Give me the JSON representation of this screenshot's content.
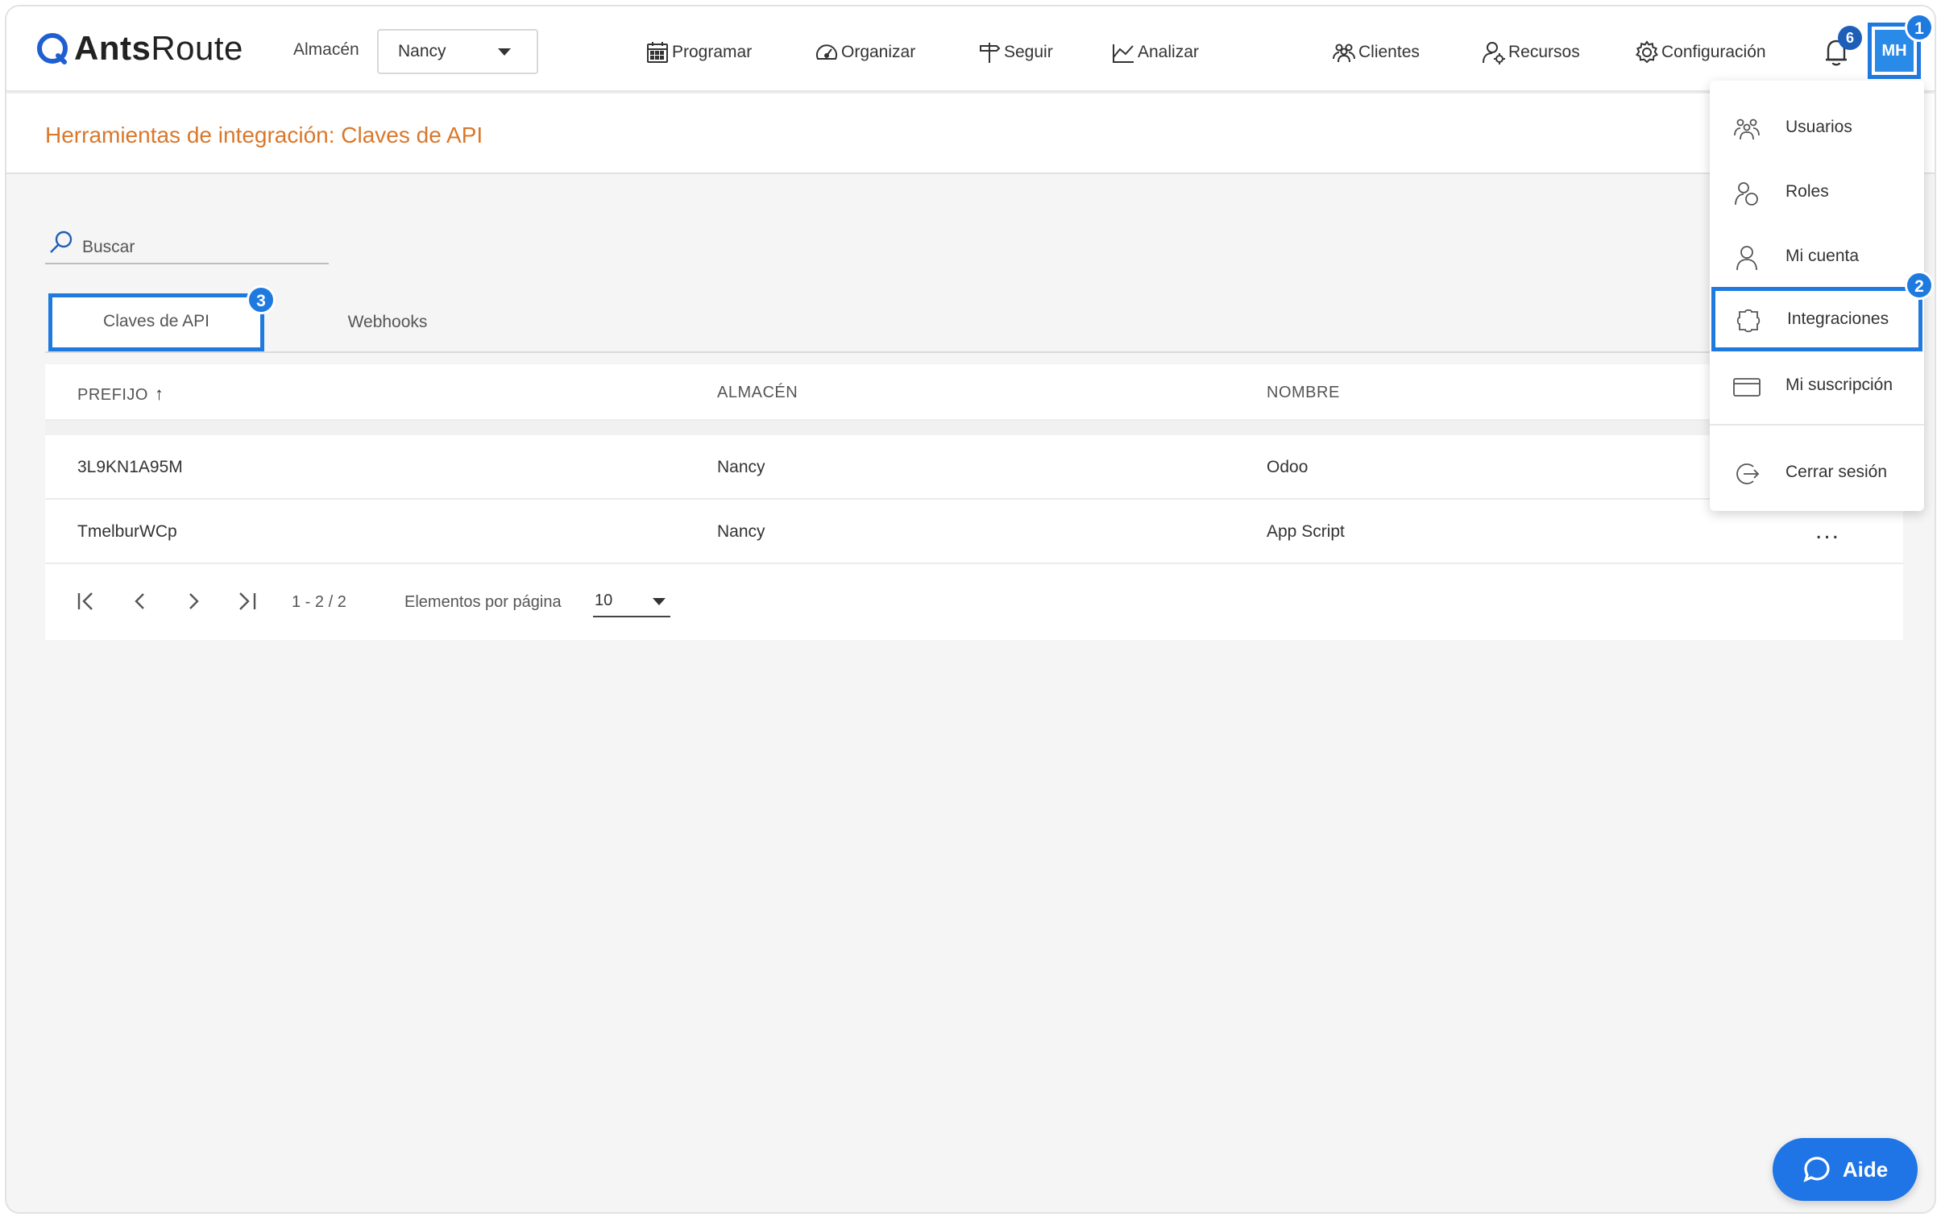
{
  "app": {
    "logo_bold": "Ants",
    "logo_light": "Route"
  },
  "header": {
    "warehouse_label": "Almacén",
    "warehouse_value": "Nancy",
    "nav": {
      "schedule": "Programar",
      "organize": "Organizar",
      "track": "Seguir",
      "analyze": "Analizar",
      "clients": "Clientes",
      "resources": "Recursos",
      "settings": "Configuración"
    },
    "notifications_count": "6",
    "avatar_initials": "MH"
  },
  "steps": {
    "one": "1",
    "two": "2",
    "three": "3"
  },
  "page": {
    "title": "Herramientas de integración: Claves de API"
  },
  "search": {
    "placeholder": "Buscar"
  },
  "tabs": {
    "api_keys": "Claves de API",
    "webhooks": "Webhooks"
  },
  "table": {
    "columns": {
      "prefix": "PREFIJO",
      "warehouse": "ALMACÉN",
      "name": "NOMBRE"
    },
    "rows": [
      {
        "prefix": "3L9KN1A95M",
        "warehouse": "Nancy",
        "name": "Odoo"
      },
      {
        "prefix": "TmelburWCp",
        "warehouse": "Nancy",
        "name": "App Script"
      }
    ],
    "row_menu": "..."
  },
  "pagination": {
    "range": "1 - 2 / 2",
    "per_page_label": "Elementos por página",
    "per_page_value": "10"
  },
  "user_menu": {
    "users": "Usuarios",
    "roles": "Roles",
    "my_account": "Mi cuenta",
    "integrations": "Integraciones",
    "subscription": "Mi suscripción",
    "logout": "Cerrar sesión"
  },
  "help": {
    "label": "Aide"
  },
  "colors": {
    "accent": "#1f7ae0",
    "title": "#d9772b",
    "help_button": "#1f74e6",
    "badge": "#1d5fb8"
  }
}
